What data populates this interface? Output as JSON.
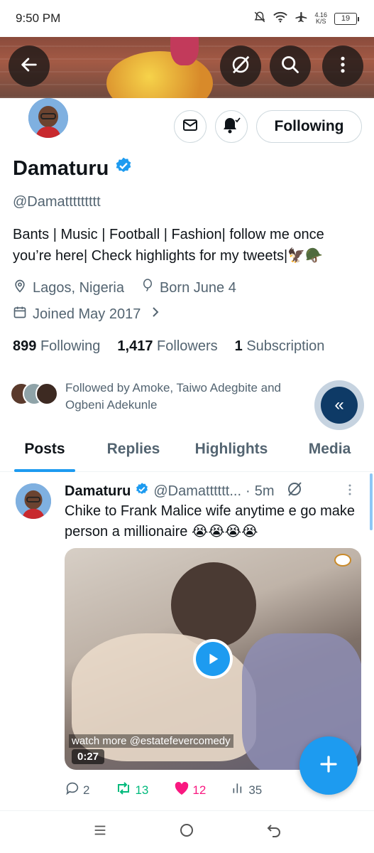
{
  "status_bar": {
    "time": "9:50 PM",
    "net_speed_value": "4.16",
    "net_speed_unit": "K/S",
    "battery": "19"
  },
  "profile": {
    "display_name": "Damaturu",
    "handle": "@Damattttttttt",
    "bio": "Bants | Music | Football | Fashion| follow me once you’re here| Check highlights for my tweets|🦅🪖",
    "location": "Lagos, Nigeria",
    "birthday": "Born June 4",
    "joined": "Joined May 2017",
    "following_count": "899",
    "following_label": "Following",
    "followers_count": "1,417",
    "followers_label": "Followers",
    "subscription_count": "1",
    "subscription_label": "Subscription",
    "followed_by_text": "Followed by Amoke, Taiwo Adegbite and Ogbeni Adekunle",
    "follow_button_label": "Following"
  },
  "tabs": [
    {
      "label": "Posts",
      "active": true
    },
    {
      "label": "Replies",
      "active": false
    },
    {
      "label": "Highlights",
      "active": false
    },
    {
      "label": "Media",
      "active": false
    }
  ],
  "post": {
    "name": "Damaturu",
    "handle": "@Damatttttt...",
    "separator": "·",
    "time": "5m",
    "text": "Chike to Frank Malice wife anytime e go make person a millionaire 😭😭😭😭",
    "video_watermark": "watch more @estatefevercomedy",
    "video_duration": "0:27",
    "replies": "2",
    "reposts": "13",
    "likes": "12",
    "views": "35"
  },
  "colors": {
    "accent": "#1d9bf0",
    "text_primary": "#0f1419",
    "text_secondary": "#536471",
    "repost_green": "#00ba7c",
    "like_pink": "#f91880"
  }
}
